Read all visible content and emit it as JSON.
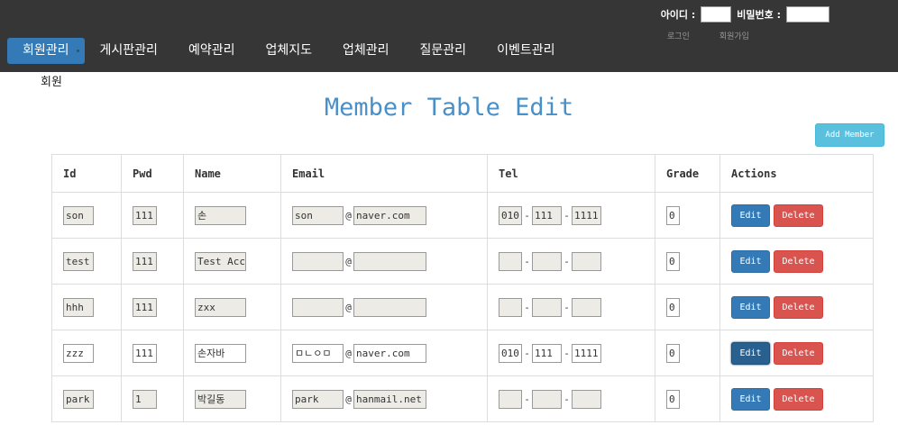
{
  "header": {
    "id_label": "아이디 :",
    "pw_label": "비밀번호 :",
    "login_link": "로그인",
    "signup_link": "회원가입"
  },
  "nav": {
    "items": [
      {
        "label": "회원관리",
        "active": true
      },
      {
        "label": "게시판관리"
      },
      {
        "label": "예약관리"
      },
      {
        "label": "업체지도"
      },
      {
        "label": "업체관리"
      },
      {
        "label": "질문관리"
      },
      {
        "label": "이벤트관리"
      }
    ]
  },
  "breadcrumb": "회원",
  "page_title": "Member Table Edit",
  "add_button": "Add Member",
  "table": {
    "headers": [
      "Id",
      "Pwd",
      "Name",
      "Email",
      "Tel",
      "Grade",
      "Actions"
    ],
    "email_at": "@",
    "tel_sep": "-",
    "edit_label": "Edit",
    "delete_label": "Delete",
    "rows": [
      {
        "id": "son",
        "pwd": "111",
        "name": "손",
        "email_user": "son",
        "email_domain": "naver.com",
        "tel1": "010",
        "tel2": "111",
        "tel3": "1111",
        "grade": "0"
      },
      {
        "id": "test",
        "pwd": "111",
        "name": "Test Account",
        "email_user": "",
        "email_domain": "",
        "tel1": "",
        "tel2": "",
        "tel3": "",
        "grade": "0"
      },
      {
        "id": "hhh",
        "pwd": "111",
        "name": "zxx",
        "email_user": "",
        "email_domain": "",
        "tel1": "",
        "tel2": "",
        "tel3": "",
        "grade": "0"
      },
      {
        "id": "zzz",
        "pwd": "111",
        "name": "손자바",
        "email_user": "ㅁㄴㅇㅁ",
        "email_domain": "naver.com",
        "tel1": "010",
        "tel2": "111",
        "tel3": "1111",
        "grade": "0"
      },
      {
        "id": "park",
        "pwd": "1",
        "name": "박길동",
        "email_user": "park",
        "email_domain": "hanmail.net",
        "tel1": "",
        "tel2": "",
        "tel3": "",
        "grade": "0"
      }
    ]
  },
  "colors": {
    "topbar": "#363636",
    "nav_active": "#337ab7",
    "title": "#4a90c8",
    "add_button": "#5bc0de",
    "edit_button": "#337ab7",
    "delete_button": "#d9534f",
    "input_bg": "#ecebe6"
  }
}
